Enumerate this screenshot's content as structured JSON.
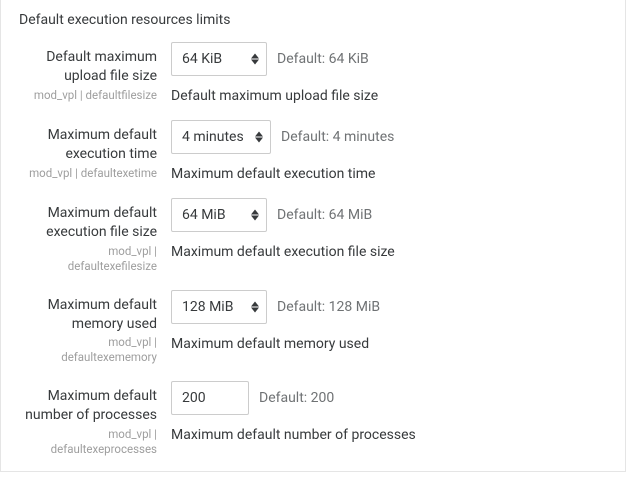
{
  "section_title": "Default execution resources limits",
  "fields": [
    {
      "label": "Default maximum upload file size",
      "tech": "mod_vpl | defaultfilesize",
      "control": "select",
      "value": "64 KiB",
      "default_hint": "Default: 64 KiB",
      "description": "Default maximum upload file size"
    },
    {
      "label": "Maximum default execution time",
      "tech": "mod_vpl | defaultexetime",
      "control": "select",
      "value": "4 minutes",
      "default_hint": "Default: 4 minutes",
      "description": "Maximum default execution time"
    },
    {
      "label": "Maximum default execution file size",
      "tech": "mod_vpl | defaultexefilesize",
      "control": "select",
      "value": "64 MiB",
      "default_hint": "Default: 64 MiB",
      "description": "Maximum default execution file size"
    },
    {
      "label": "Maximum default memory used",
      "tech": "mod_vpl | defaultexememory",
      "control": "select",
      "value": "128 MiB",
      "default_hint": "Default: 128 MiB",
      "description": "Maximum default memory used"
    },
    {
      "label": "Maximum default number of processes",
      "tech": "mod_vpl | defaultexeprocesses",
      "control": "input",
      "value": "200",
      "default_hint": "Default: 200",
      "description": "Maximum default number of processes"
    }
  ]
}
